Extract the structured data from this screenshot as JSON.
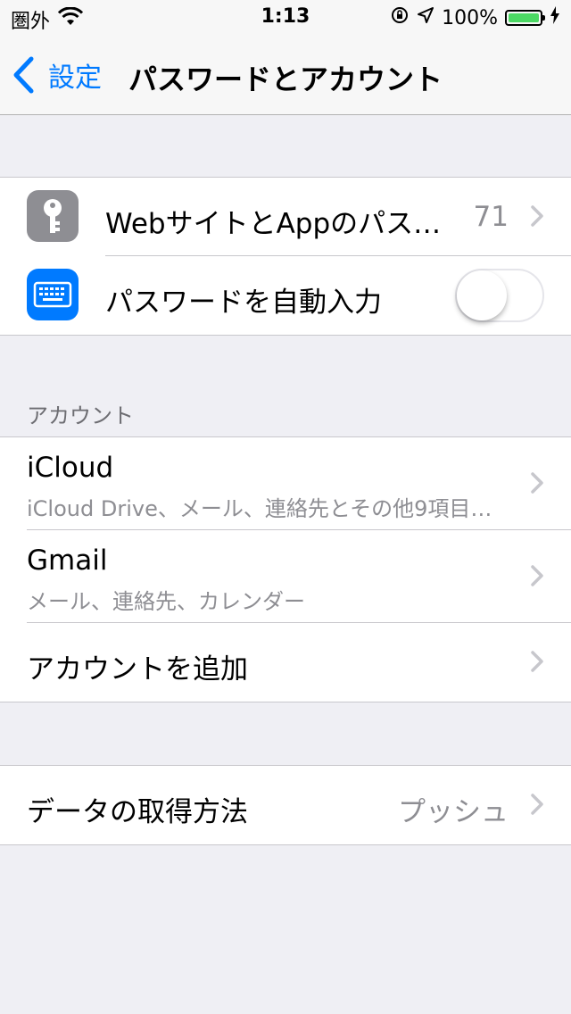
{
  "status_bar": {
    "carrier": "圏外",
    "time": "1:13",
    "battery_percent": "100%",
    "battery_level": 1.0,
    "battery_color": "#4cd964"
  },
  "nav": {
    "back_label": "設定",
    "title": "パスワードとアカウント",
    "accent_color": "#007aff"
  },
  "passwords_group": {
    "websites_label": "WebサイトとAppのパス…",
    "websites_count": "71",
    "autofill_label": "パスワードを自動入力",
    "autofill_enabled": false
  },
  "accounts_section": {
    "header": "アカウント",
    "accounts": [
      {
        "name": "iCloud",
        "detail": "iCloud Drive、メール、連絡先とその他9項目…"
      },
      {
        "name": "Gmail",
        "detail": "メール、連絡先、カレンダー"
      }
    ],
    "add_account_label": "アカウントを追加"
  },
  "fetch_group": {
    "label": "データの取得方法",
    "value": "プッシュ"
  },
  "icons": [
    "wifi-icon",
    "orientation-lock-icon",
    "location-arrow-icon",
    "charging-bolt-icon",
    "back-chevron-icon",
    "key-icon",
    "keyboard-icon",
    "disclosure-chevron-icon"
  ]
}
